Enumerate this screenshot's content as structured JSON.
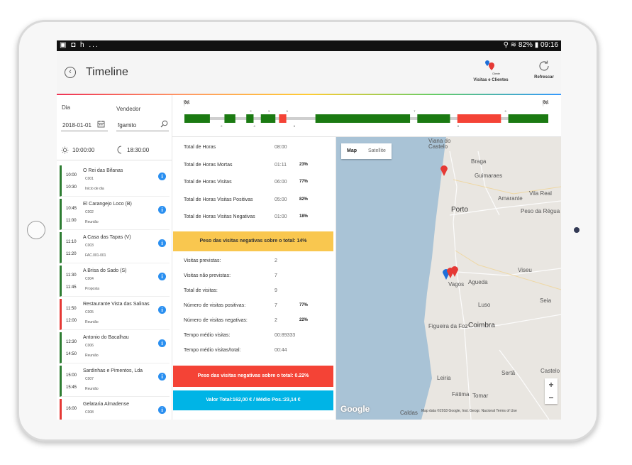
{
  "status": {
    "left": "▣ ◘ h ...",
    "right": "⚲ ≋ 82% ▮ 09:16"
  },
  "header": {
    "title": "Timeline",
    "action1_label": "Visitas e Clientes",
    "action1_tiny": "Cliente",
    "action2_label": "Refrescar"
  },
  "filters": {
    "day_label": "Dia",
    "seller_label": "Vendedor",
    "date": "2018-01-01",
    "seller": "fgamito",
    "start_time": "10:00:00",
    "end_time": "18:30:00"
  },
  "visits": [
    {
      "start": "10:00",
      "end": "10:30",
      "name": "O Rei das Bifanas",
      "code": "C001",
      "status": "Inicio de dia",
      "outcome": "positive"
    },
    {
      "start": "10:45",
      "end": "11:00",
      "name": "El Carangejo Loco (B)",
      "code": "C002",
      "status": "Reunião",
      "outcome": "positive"
    },
    {
      "start": "11:10",
      "end": "11:20",
      "name": "A Casa das Tapas (V)",
      "code": "C003",
      "status": "FAC.001-001",
      "outcome": "positive"
    },
    {
      "start": "11:30",
      "end": "11:45",
      "name": "A Brisa do Sado (S)",
      "code": "C004",
      "status": "Proposta",
      "outcome": "positive"
    },
    {
      "start": "11:50",
      "end": "12:00",
      "name": "Restaurante Vista das Salinas",
      "code": "C005",
      "status": "Reunião",
      "outcome": "negative"
    },
    {
      "start": "12:30",
      "end": "14:50",
      "name": "Antonio do Bacalhau",
      "code": "C006",
      "status": "Reunião",
      "outcome": "positive"
    },
    {
      "start": "15:00",
      "end": "15:45",
      "name": "Sardinhas e Pimentos, Lda",
      "code": "C007",
      "status": "Reunião",
      "outcome": "positive"
    },
    {
      "start": "16:00",
      "end": "",
      "name": "Gelataria Almadense",
      "code": "C008",
      "status": "",
      "outcome": "negative"
    }
  ],
  "timeline": {
    "start_flag": "🏁",
    "end_flag": "🏁",
    "segments": [
      {
        "start": 0.0,
        "end": 0.07,
        "outcome": "positive"
      },
      {
        "start": 0.11,
        "end": 0.14,
        "outcome": "positive"
      },
      {
        "start": 0.17,
        "end": 0.19,
        "outcome": "positive"
      },
      {
        "start": 0.21,
        "end": 0.25,
        "outcome": "positive"
      },
      {
        "start": 0.26,
        "end": 0.28,
        "outcome": "negative"
      },
      {
        "start": 0.36,
        "end": 0.62,
        "outcome": "positive"
      },
      {
        "start": 0.64,
        "end": 0.73,
        "outcome": "positive"
      },
      {
        "start": 0.75,
        "end": 0.87,
        "outcome": "negative"
      },
      {
        "start": 0.89,
        "end": 1.0,
        "outcome": "positive"
      }
    ],
    "marks_top": [
      {
        "label": "2",
        "pos": 0.18
      },
      {
        "label": "3",
        "pos": 0.23
      },
      {
        "label": "5",
        "pos": 0.28
      },
      {
        "label": "7",
        "pos": 0.63
      },
      {
        "label": "9",
        "pos": 0.88
      }
    ],
    "marks_bottom": [
      {
        "label": "2",
        "pos": 0.1
      },
      {
        "label": "4",
        "pos": 0.19
      },
      {
        "label": "6",
        "pos": 0.3
      },
      {
        "label": "8",
        "pos": 0.75
      }
    ]
  },
  "summary": {
    "rows": [
      {
        "label": "Total de Horas",
        "value": "08:00",
        "pct": ""
      },
      {
        "label": "Total de Horas Mortas",
        "value": "01:11",
        "pct": "23%"
      },
      {
        "label": "Total de Horas Visitas",
        "value": "06:00",
        "pct": "77%"
      },
      {
        "label": "Total de Horas Visitas Positivas",
        "value": "05:00",
        "pct": "82%"
      },
      {
        "label": "Total de Horas Visitas Negativas",
        "value": "01:00",
        "pct": "18%"
      }
    ],
    "banner_hours": "Peso das visitas negativas sobre o total: 14%",
    "visit_rows": [
      {
        "label": "Visitas previstas:",
        "value": "2",
        "pct": ""
      },
      {
        "label": "Visitas não previstas:",
        "value": "7",
        "pct": ""
      },
      {
        "label": "Total de visitas:",
        "value": "9",
        "pct": ""
      },
      {
        "label": "Número de visitas positivas:",
        "value": "7",
        "pct": "77%"
      },
      {
        "label": "Número de visitas negativas:",
        "value": "2",
        "pct": "22%"
      },
      {
        "label": "Tempo médio visitas:",
        "value": "00:89333",
        "pct": ""
      },
      {
        "label": "Tempo médio visitas/total:",
        "value": "00:44",
        "pct": ""
      }
    ],
    "banner_visits": "Peso das visitas negativas sobre o total: 0.22%",
    "banner_value": "Valor Total:162,00 € / Médio Pos.:23,14 €"
  },
  "colors": {
    "positive": "#2e7d32",
    "negative": "#f44336",
    "warning": "#f9c74f",
    "info": "#00b4e6",
    "accent": "#2a8ff0"
  },
  "map": {
    "type_map": "Map",
    "type_satellite": "Satellite",
    "labels": [
      "Viana do Castelo",
      "Braga",
      "Guimaraes",
      "Amarante",
      "Vila Real",
      "Porto",
      "Peso da Régua",
      "Vagos",
      "Agueda",
      "Viseu",
      "Luso",
      "Seia",
      "Figueira da Foz",
      "Coimbra",
      "Leiria",
      "Sertã",
      "Castelo",
      "Fátima",
      "Tomar",
      "Caldas"
    ],
    "zoom_in": "+",
    "zoom_out": "−",
    "attribution": "Map data ©2018 Google, Inst. Geogr. Nacional   Terms of Use",
    "google": "Google"
  }
}
